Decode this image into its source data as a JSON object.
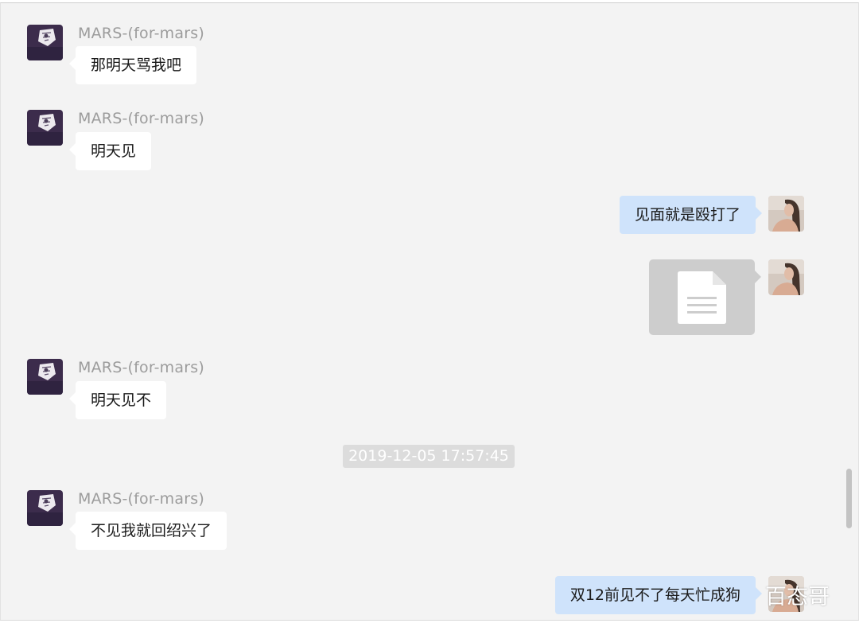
{
  "conversation": {
    "messages": [
      {
        "direction": "incoming",
        "sender": "MARS-(for-mars)",
        "text": "那明天骂我吧"
      },
      {
        "direction": "incoming",
        "sender": "MARS-(for-mars)",
        "text": "明天见"
      },
      {
        "direction": "outgoing",
        "text": "见面就是殴打了"
      },
      {
        "direction": "outgoing",
        "type": "file",
        "icon": "document-icon"
      },
      {
        "direction": "incoming",
        "sender": "MARS-(for-mars)",
        "text": "明天见不"
      },
      {
        "type": "timestamp",
        "text": "2019-12-05 17:57:45"
      },
      {
        "direction": "incoming",
        "sender": "MARS-(for-mars)",
        "text": "不见我就回绍兴了"
      },
      {
        "direction": "outgoing",
        "text": "双12前见不了每天忙成狗"
      }
    ]
  },
  "watermark": {
    "text": "百态哥"
  },
  "colors": {
    "background": "#f3f3f3",
    "incoming_bubble": "#ffffff",
    "outgoing_bubble": "#cfe3fb",
    "sender_name": "#9c9c9c",
    "timestamp_bg": "#dcdcdc",
    "file_bubble": "#cdcdcd"
  }
}
